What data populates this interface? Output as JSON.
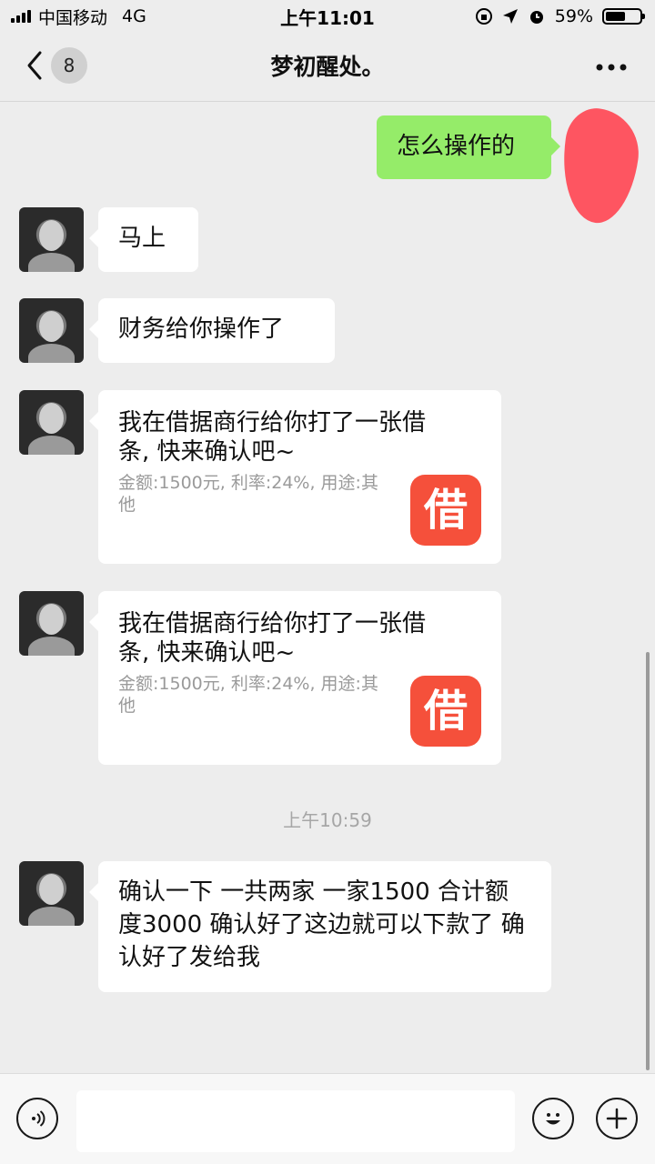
{
  "status_bar": {
    "carrier": "中国移动",
    "network": "4G",
    "time": "上午11:01",
    "battery_percent": "59%",
    "battery_level": 0.59
  },
  "nav": {
    "unread_count": "8",
    "title": "梦初醒处。"
  },
  "messages": {
    "mine_1": "怎么操作的",
    "msg_1": "马上",
    "msg_2": "财务给你操作了",
    "card_1": {
      "title": "我在借据商行给你打了一张借条, 快来确认吧~",
      "desc": "金额:1500元, 利率:24%, 用途:其他",
      "icon_text": "借"
    },
    "card_2": {
      "title": "我在借据商行给你打了一张借条, 快来确认吧~",
      "desc": "金额:1500元, 利率:24%, 用途:其他",
      "icon_text": "借"
    },
    "timestamp": "上午10:59",
    "msg_3": "确认一下  一共两家 一家1500 合计额度3000   确认好了这边就可以下款了  确认好了发给我"
  },
  "colors": {
    "background": "#ededed",
    "my_bubble": "#95ec69",
    "their_bubble": "#ffffff",
    "card_icon": "#f5503b"
  },
  "icons": {
    "back": "chevron-left-icon",
    "more": "more-dots-icon",
    "voice": "voice-icon",
    "emoji": "emoji-icon",
    "plus": "plus-icon"
  }
}
